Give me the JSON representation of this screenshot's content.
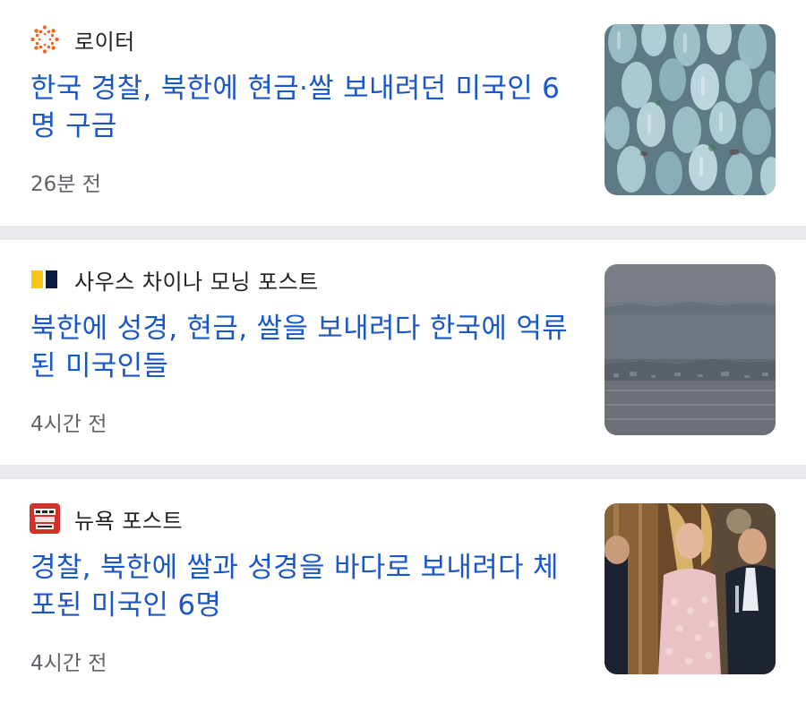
{
  "articles": [
    {
      "source": "로이터",
      "source_icon": "reuters-logo-icon",
      "headline": "한국 경찰, 북한에 현금·쌀 보내려던 미국인 6명 구금",
      "time": "26분 전",
      "thumbnail": "plastic-bottles-thumbnail"
    },
    {
      "source": "사우스 차이나 모닝 포스트",
      "source_icon": "scmp-logo-icon",
      "headline": "북한에 성경, 현금, 쌀을 보내려다 한국에 억류된 미국인들",
      "time": "4시간 전",
      "thumbnail": "border-landscape-thumbnail"
    },
    {
      "source": "뉴욕 포스트",
      "source_icon": "ny-post-logo-icon",
      "headline": "경찰, 북한에 쌀과 성경을 바다로 보내려다 체포된 미국인 6명",
      "time": "4시간 전",
      "thumbnail": "people-event-thumbnail"
    }
  ],
  "colors": {
    "headline": "#1a57c8",
    "divider": "#e8eaed",
    "timestamp": "#5f6368"
  }
}
